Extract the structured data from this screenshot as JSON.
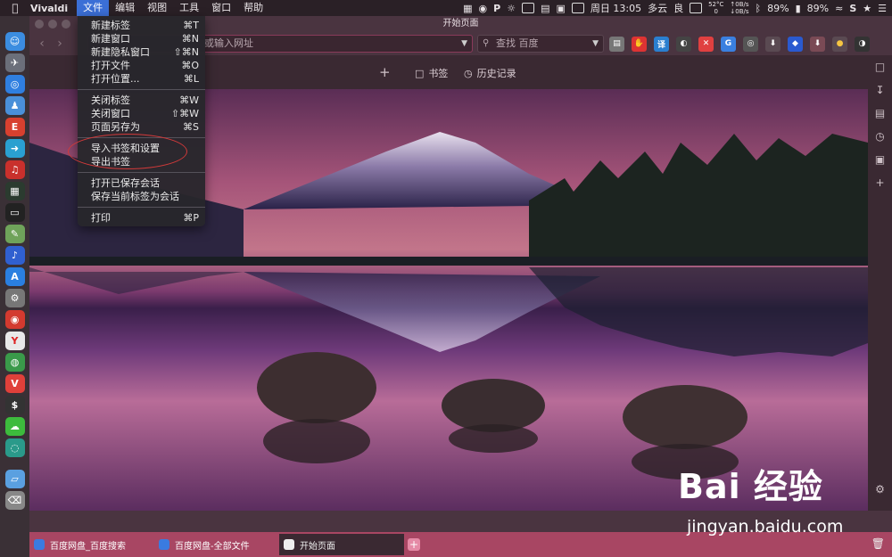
{
  "menubar": {
    "app_name": "Vivaldi",
    "menus": [
      "文件",
      "编辑",
      "视图",
      "工具",
      "窗口",
      "帮助"
    ],
    "status": {
      "temp": "52°C",
      "temp_sub": "0",
      "net_up": "0B/s",
      "net_down": "0B/s",
      "datetime": "周日 13:05",
      "weather": "多云",
      "air": "良",
      "battery1": "89%",
      "battery2": "89%"
    }
  },
  "window": {
    "title": "开始页面",
    "url_placeholder": "或输入网址",
    "search_placeholder": "查找 百度"
  },
  "bookmark_bar": {
    "bookmarks_label": "书签",
    "history_label": "历史记录"
  },
  "file_menu": {
    "groups": [
      [
        {
          "label": "新建标签",
          "shortcut": "⌘T"
        },
        {
          "label": "新建窗口",
          "shortcut": "⌘N"
        },
        {
          "label": "新建隐私窗口",
          "shortcut": "⇧⌘N"
        },
        {
          "label": "打开文件",
          "shortcut": "⌘O"
        },
        {
          "label": "打开位置...",
          "shortcut": "⌘L"
        }
      ],
      [
        {
          "label": "关闭标签",
          "shortcut": "⌘W"
        },
        {
          "label": "关闭窗口",
          "shortcut": "⇧⌘W"
        },
        {
          "label": "页面另存为",
          "shortcut": "⌘S"
        }
      ],
      [
        {
          "label": "导入书签和设置",
          "shortcut": ""
        },
        {
          "label": "导出书签",
          "shortcut": ""
        }
      ],
      [
        {
          "label": "打开已保存会话",
          "shortcut": ""
        },
        {
          "label": "保存当前标签为会话",
          "shortcut": ""
        }
      ],
      [
        {
          "label": "打印",
          "shortcut": "⌘P"
        }
      ]
    ]
  },
  "tabs": [
    {
      "label": "百度网盘_百度搜索",
      "color": "#3a7be0"
    },
    {
      "label": "百度网盘-全部文件",
      "color": "#3a7be0"
    },
    {
      "label": "开始页面",
      "color": "#ffffff"
    }
  ],
  "watermark": {
    "brand": "Bai  经验",
    "url": "jingyan.baidu.com"
  },
  "colors": {
    "accent": "#a84663",
    "menu_highlight": "#3b6fd6",
    "annotation": "#d33a3a"
  }
}
